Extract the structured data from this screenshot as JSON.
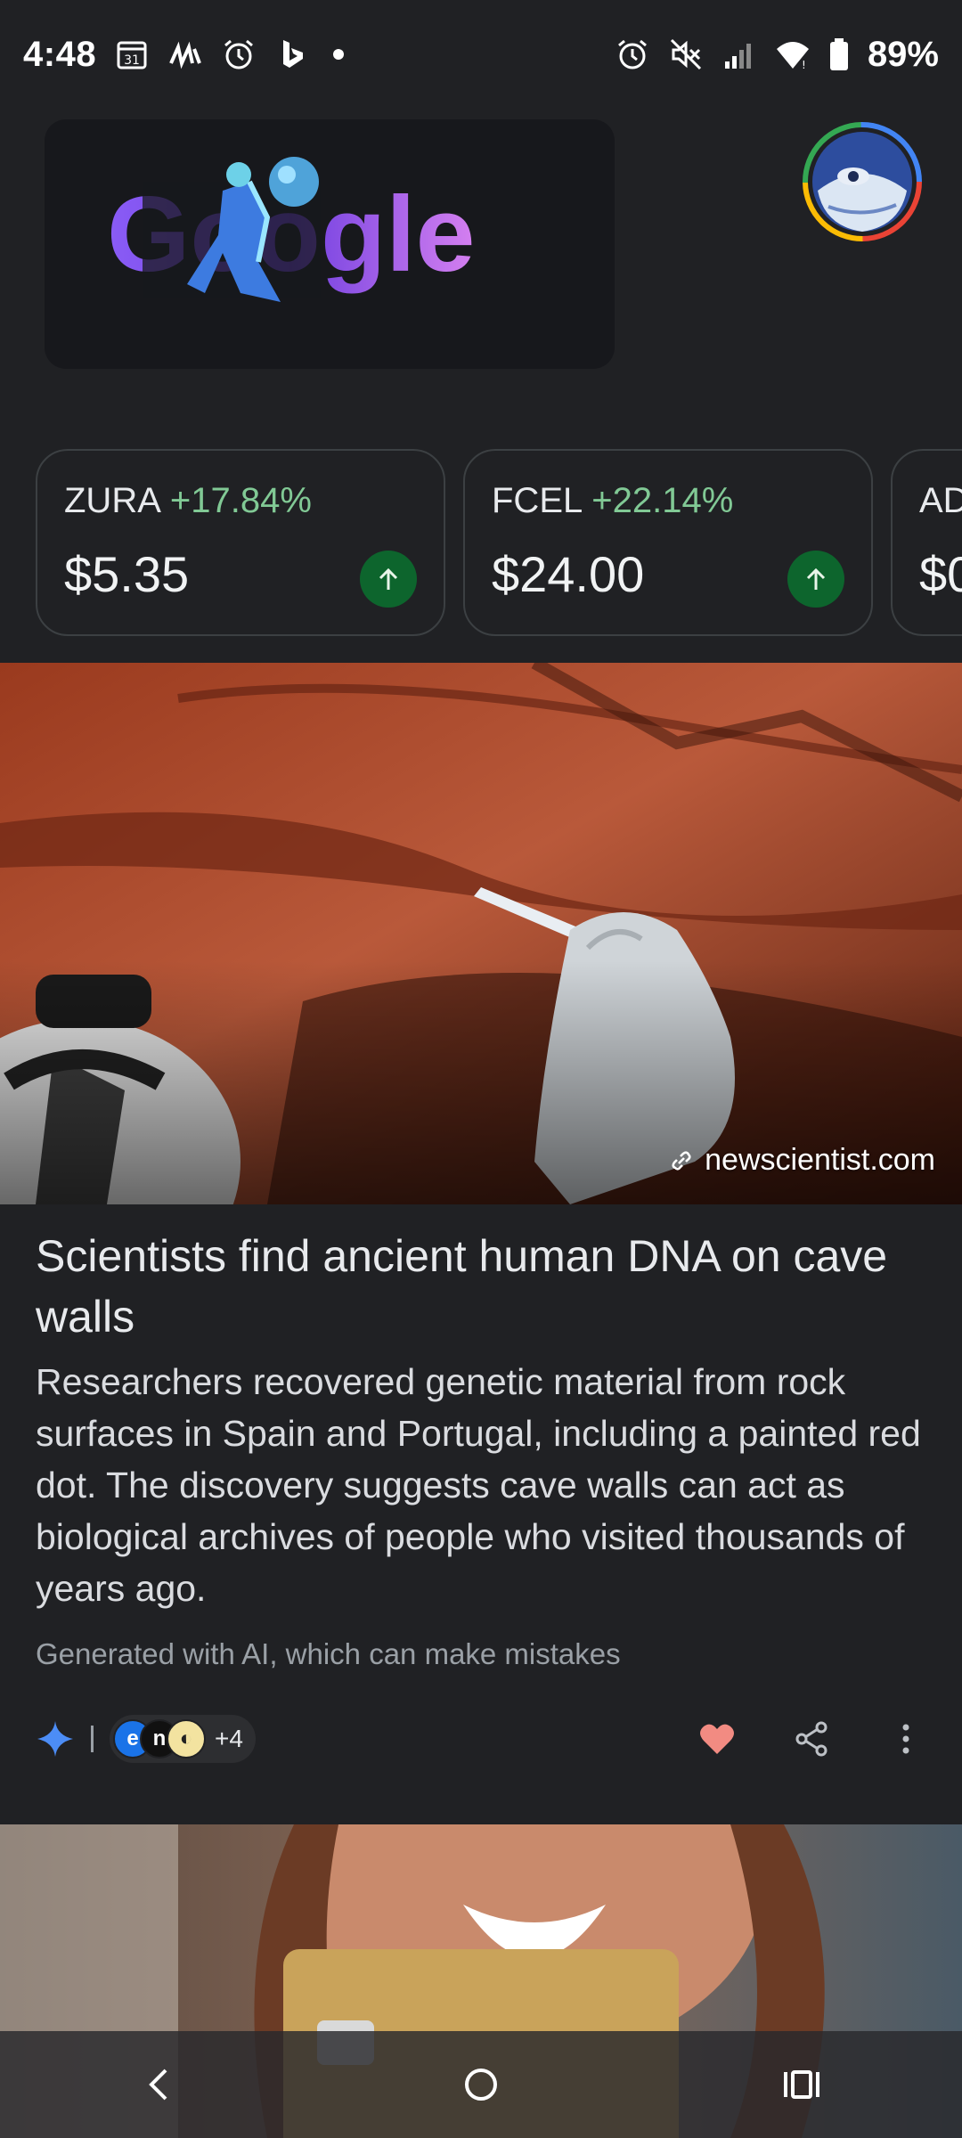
{
  "status_bar": {
    "time": "4:48",
    "battery_percent": "89%",
    "left_icons": [
      "calendar-icon",
      "app-logo-icon",
      "alarm-icon",
      "bing-icon"
    ],
    "right_icons": [
      "alarm-icon",
      "mute-icon",
      "signal-icon",
      "wifi-icon",
      "battery-icon"
    ]
  },
  "doodle": {
    "text": "Google"
  },
  "stocks": [
    {
      "ticker": "ZURA",
      "change": "+17.84%",
      "price": "$5.35",
      "direction": "up"
    },
    {
      "ticker": "FCEL",
      "change": "+22.14%",
      "price": "$24.00",
      "direction": "up"
    },
    {
      "ticker": "AD",
      "change": "",
      "price": "$0",
      "direction": "up"
    }
  ],
  "article": {
    "source": "newscientist.com",
    "title": "Scientists find ancient human DNA on cave walls",
    "summary": "Researchers recovered genetic material from rock surfaces in Spain and Portugal, including a painted red dot. The discovery suggests cave walls can act as biological archives of people who visited thousands of years ago.",
    "disclaimer": "Generated with AI, which can make mistakes",
    "more_sources": "+4"
  },
  "colors": {
    "background": "#202124",
    "positive": "#81c995",
    "up_badge": "#0d652d",
    "heart": "#f28b82"
  }
}
